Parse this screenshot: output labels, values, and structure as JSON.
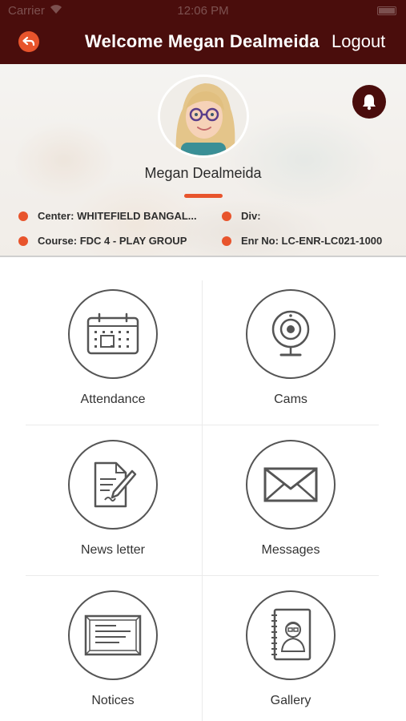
{
  "status_bar": {
    "carrier": "Carrier",
    "time": "12:06 PM"
  },
  "header": {
    "title": "Welcome Megan Dealmeida",
    "logout_label": "Logout"
  },
  "profile": {
    "name": "Megan Dealmeida",
    "center": "Center: WHITEFIELD BANGAL...",
    "div": "Div:",
    "course": "Course: FDC 4 - PLAY GROUP",
    "enrollment": "Enr No: LC-ENR-LC021-1000"
  },
  "menu": [
    {
      "label": "Attendance",
      "icon": "calendar-icon"
    },
    {
      "label": "Cams",
      "icon": "webcam-icon"
    },
    {
      "label": "News letter",
      "icon": "newsletter-icon"
    },
    {
      "label": "Messages",
      "icon": "envelope-icon"
    },
    {
      "label": "Notices",
      "icon": "notice-board-icon"
    },
    {
      "label": "Gallery",
      "icon": "gallery-album-icon"
    }
  ],
  "colors": {
    "header_bg": "#4a0d0c",
    "accent": "#e8542c",
    "icon_stroke": "#555555"
  }
}
